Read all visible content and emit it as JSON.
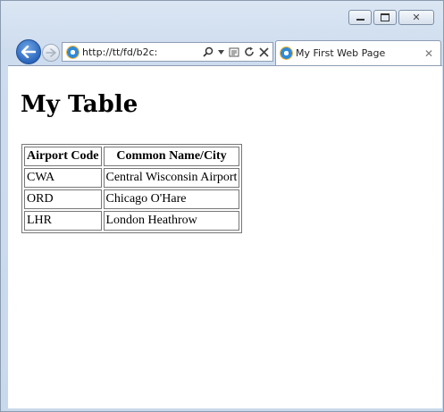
{
  "browser": {
    "address": "http://tt/fd/b2c:",
    "tab_title": "My First Web Page",
    "close_glyph": "✕"
  },
  "page": {
    "heading": "My Table",
    "table": {
      "headers": [
        "Airport Code",
        "Common Name/City"
      ],
      "rows": [
        [
          "CWA",
          "Central Wisconsin Airport"
        ],
        [
          "ORD",
          "Chicago O'Hare"
        ],
        [
          "LHR",
          "London Heathrow"
        ]
      ]
    }
  }
}
